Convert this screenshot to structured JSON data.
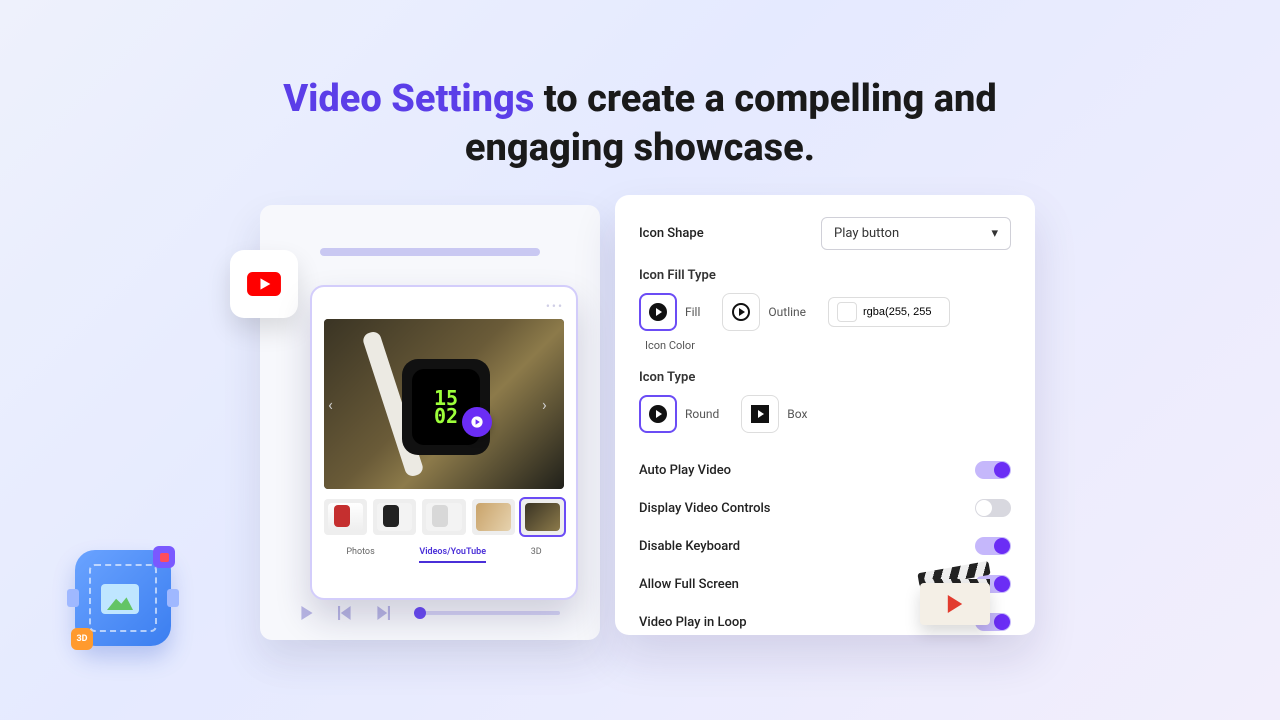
{
  "headline": {
    "accent": "Video Settings",
    "rest1": " to create a compelling and",
    "rest2": "engaging showcase."
  },
  "gallery": {
    "time": "15\n02",
    "tabs": [
      "Photos",
      "Videos/YouTube",
      "3D"
    ],
    "active_tab": 1
  },
  "settings": {
    "icon_shape": {
      "label": "Icon Shape",
      "value": "Play button"
    },
    "icon_fill_type": {
      "label": "Icon Fill Type",
      "options": [
        {
          "key": "fill",
          "label": "Fill",
          "selected": true
        },
        {
          "key": "outline",
          "label": "Outline",
          "selected": false
        }
      ],
      "color_value": "rgba(255, 255",
      "color_label": "Icon Color"
    },
    "icon_type": {
      "label": "Icon Type",
      "options": [
        {
          "key": "round",
          "label": "Round",
          "selected": true
        },
        {
          "key": "box",
          "label": "Box",
          "selected": false
        }
      ]
    },
    "toggles": [
      {
        "key": "autoplay",
        "label": "Auto Play Video",
        "on": true
      },
      {
        "key": "controls",
        "label": "Display Video Controls",
        "on": false
      },
      {
        "key": "keyboard",
        "label": "Disable Keyboard",
        "on": true
      },
      {
        "key": "fullscreen",
        "label": "Allow Full Screen",
        "on": true
      },
      {
        "key": "loop",
        "label": "Video Play in Loop",
        "on": true
      }
    ]
  },
  "deco": {
    "badge3d": "3D"
  }
}
